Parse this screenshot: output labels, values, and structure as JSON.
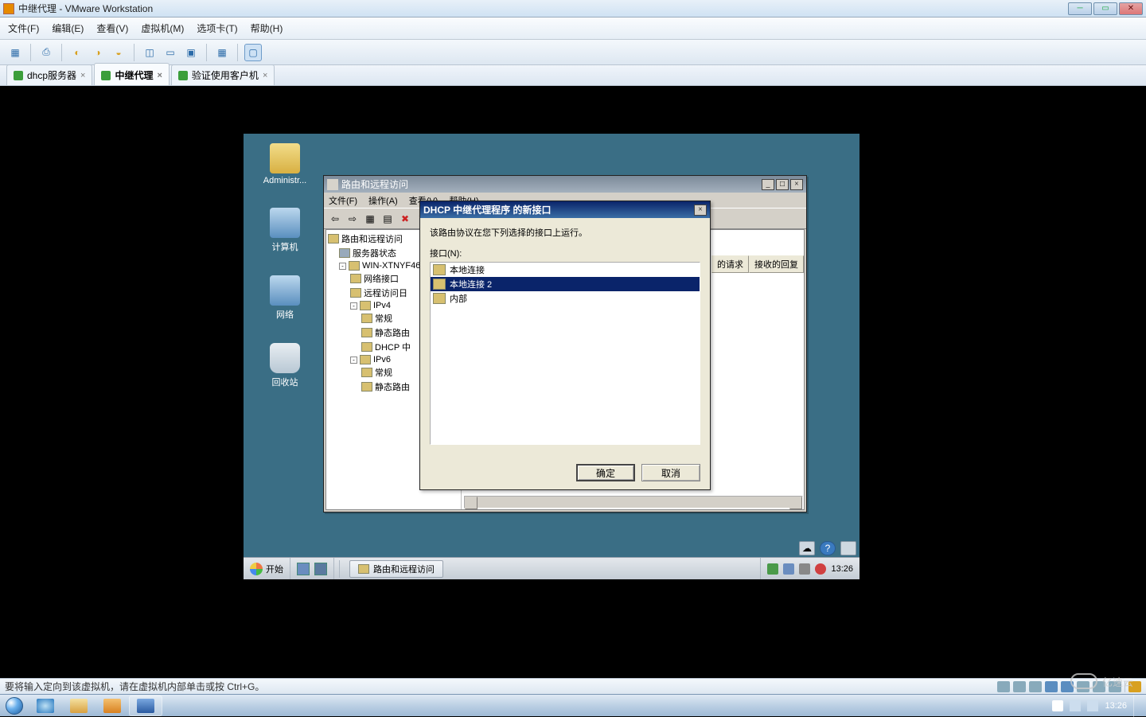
{
  "host": {
    "title": "中继代理 - VMware Workstation",
    "menu": {
      "file": "文件(F)",
      "edit": "编辑(E)",
      "view": "查看(V)",
      "vm": "虚拟机(M)",
      "tabs": "选项卡(T)",
      "help": "帮助(H)"
    },
    "tabs": [
      {
        "label": "dhcp服务器",
        "active": false
      },
      {
        "label": "中继代理",
        "active": true
      },
      {
        "label": "验证使用客户机",
        "active": false
      }
    ],
    "status": "要将输入定向到该虚拟机，请在虚拟机内部单击或按 Ctrl+G。",
    "watermark": "亿速云"
  },
  "guest": {
    "desktop_icons": [
      {
        "name": "Administr...",
        "color": "#e2c96b"
      },
      {
        "name": "计算机",
        "color": "#6aa7d6"
      },
      {
        "name": "网络",
        "color": "#6aa7d6"
      },
      {
        "name": "回收站",
        "color": "#dfe6eb"
      }
    ],
    "start_label": "开始",
    "task_item": "路由和远程访问",
    "clock": "13:26",
    "toprt": {
      "info": "ℹ",
      "help": "?"
    }
  },
  "rras": {
    "title": "路由和远程访问",
    "menu": {
      "file": "文件(F)",
      "action": "操作(A)",
      "view": "查看(V)",
      "help": "帮助(H)"
    },
    "tree": {
      "root": "路由和远程访问",
      "status": "服务器状态",
      "server": "WIN-XTNYF465Y",
      "netif": "网络接口",
      "ralog": "远程访问日",
      "ipv4": "IPv4",
      "general": "常规",
      "static4": "静态路由",
      "dhcp": "DHCP 中",
      "ipv6": "IPv6",
      "static6": "静态路由"
    },
    "cols": {
      "req": "的请求",
      "reply": "接收的回复"
    }
  },
  "dlg": {
    "title": "DHCP 中继代理程序 的新接口",
    "prompt": "该路由协议在您下列选择的接口上运行。",
    "listlabel": "接口(N):",
    "items": [
      {
        "label": "本地连接",
        "sel": false
      },
      {
        "label": "本地连接 2",
        "sel": true
      },
      {
        "label": "内部",
        "sel": false
      }
    ],
    "ok": "确定",
    "cancel": "取消"
  },
  "win7": {
    "time": "13:26"
  }
}
